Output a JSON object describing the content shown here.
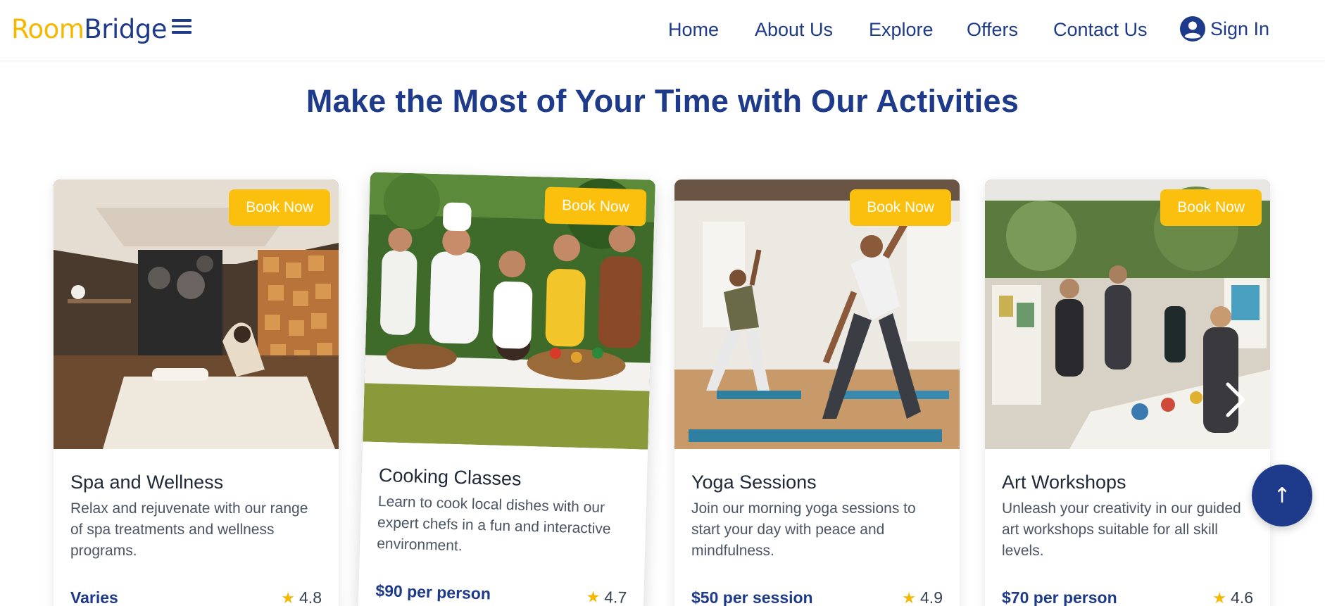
{
  "brand": {
    "part1": "Room",
    "part2": "Bridge",
    "accent": "#f5b800",
    "primary": "#1e3a8a"
  },
  "nav": {
    "items": [
      "Home",
      "About Us",
      "Explore",
      "Offers",
      "Contact Us"
    ],
    "sign_in": "Sign In"
  },
  "section": {
    "title": "Make the Most of Your Time with Our Activities"
  },
  "cards": [
    {
      "button": "Book Now",
      "title": "Spa and Wellness",
      "description": "Relax and rejuvenate with our range of spa treatments and wellness programs.",
      "price": "Varies",
      "rating": "4.8",
      "image": "spa-room-photo"
    },
    {
      "button": "Book Now",
      "title": "Cooking Classes",
      "description": "Learn to cook local dishes with our expert chefs in a fun and interactive environment.",
      "price": "$90 per person",
      "rating": "4.7",
      "image": "cooking-class-photo"
    },
    {
      "button": "Book Now",
      "title": "Yoga Sessions",
      "description": "Join our morning yoga sessions to start your day with peace and mindfulness.",
      "price": "$50 per session",
      "rating": "4.9",
      "image": "yoga-class-photo"
    },
    {
      "button": "Book Now",
      "title": "Art Workshops",
      "description": "Unleash your creativity in our guided art workshops suitable for all skill levels.",
      "price": "$70 per person",
      "rating": "4.6",
      "image": "art-workshop-photo"
    }
  ],
  "icons": {
    "star": "★",
    "scroll_top": "↑",
    "menu": "hamburger-icon",
    "user": "user-circle-icon",
    "next": "chevron-right-icon"
  }
}
